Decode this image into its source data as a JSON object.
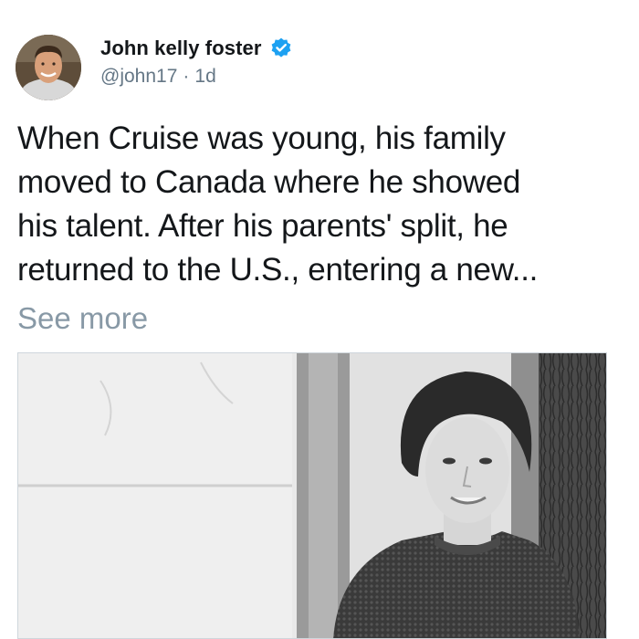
{
  "tweet": {
    "author": {
      "display_name": "John kelly foster",
      "handle": "@john17",
      "separator": "·",
      "time": "1d",
      "verified": true,
      "verified_color": "#1da1f2",
      "avatar_icon": "profile-photo"
    },
    "text_lines": [
      "When Cruise was young, his family",
      "moved to Canada where he showed",
      "his talent. After his parents' split, he",
      "returned to the U.S., entering a new..."
    ],
    "see_more": "See more",
    "media": {
      "type": "black-and-white photo",
      "icon": "photo-image"
    }
  }
}
